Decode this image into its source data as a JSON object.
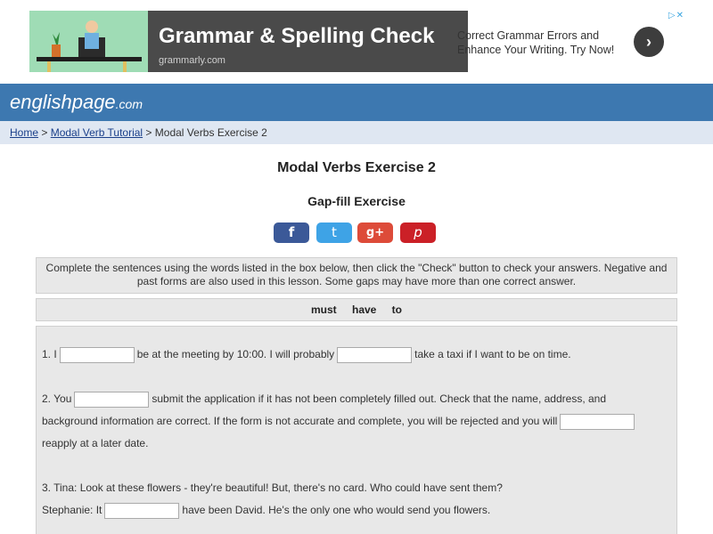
{
  "ad": {
    "headline": "Grammar & Spelling Check",
    "domain": "grammarly.com",
    "tagline": "Correct Grammar Errors and Enhance Your Writing. Try Now!",
    "arrow": "›",
    "choices": "▷✕"
  },
  "site": {
    "logo_main": "englishpage",
    "logo_tld": ".com"
  },
  "breadcrumb": {
    "home": "Home",
    "sep1": " > ",
    "tutorial": "Modal Verb Tutorial",
    "sep2": " > ",
    "current": "Modal Verbs Exercise 2"
  },
  "page": {
    "title": "Modal Verbs Exercise 2",
    "subtitle": "Gap-fill Exercise"
  },
  "share": {
    "facebook": "f",
    "twitter": "t",
    "googleplus": "g+",
    "pinterest": "p"
  },
  "instructions": "Complete the sentences using the words listed in the box below, then click the \"Check\" button to check your answers. Negative and past forms are also used in this lesson. Some gaps may have more than one correct answer.",
  "word_box": "must have to",
  "questions": {
    "q1": {
      "part1": "1. I",
      "part2": "be at the meeting by 10:00. I will probably",
      "part3": "take a taxi if I want to be on time."
    },
    "q2": {
      "part1": "2. You",
      "part2": "submit the application if it has not been completely filled out. Check that the name, address, and",
      "part3": "background information are correct. If the form is not accurate and complete, you will be rejected and you will",
      "part4": "reapply at a later date."
    },
    "q3": {
      "part1": "3. Tina: Look at these flowers - they're beautiful! But, there's no card. Who could have sent them?",
      "part2": "Stephanie: It",
      "part3": "have been David. He's the only one who would send you flowers."
    }
  }
}
